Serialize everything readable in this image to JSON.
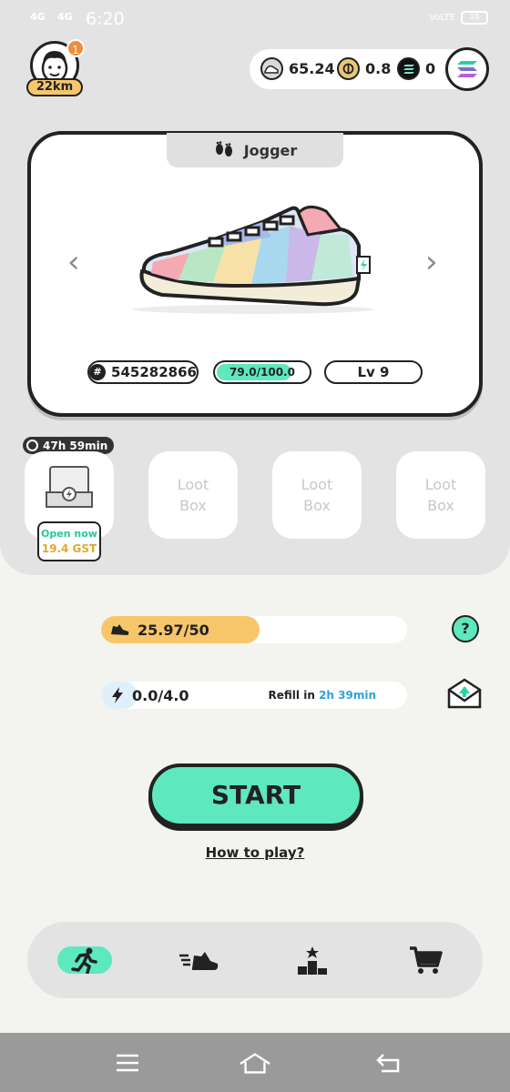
{
  "status_bar": {
    "signal_1": "4G",
    "signal_2": "4G",
    "time": "6:20",
    "volte": "VoLTE",
    "battery": "18"
  },
  "profile": {
    "notification_count": "1",
    "distance": "22km"
  },
  "balances": [
    {
      "icon": "gst-coin-icon",
      "value": "65.24"
    },
    {
      "icon": "gmt-coin-icon",
      "value": "0.8"
    },
    {
      "icon": "sol-coin-icon",
      "value": "0"
    }
  ],
  "sneaker": {
    "type": "Jogger",
    "id": "545282866",
    "durability": "79.0/100.0",
    "durability_fraction": 0.79,
    "level": "Lv 9",
    "colors": {
      "outline": "#222222",
      "sole": "#f2ecd9",
      "tongue": "#f4a9b3",
      "lace": "#a8b8e8"
    }
  },
  "mystery_box": {
    "timer": "47h 59min",
    "open_label": "Open now",
    "open_cost": "19.4 GST"
  },
  "loot_boxes": [
    {
      "line1": "Loot",
      "line2": "Box"
    },
    {
      "line1": "Loot",
      "line2": "Box"
    },
    {
      "line1": "Loot",
      "line2": "Box"
    }
  ],
  "earning_cap": {
    "value": "25.97/50",
    "fraction": 0.519,
    "color": "#f7c66a"
  },
  "energy": {
    "value": "0.0/4.0",
    "fraction": 0.0,
    "refill_label": "Refill in",
    "refill_time": "2h 39min"
  },
  "help": {
    "label": "?"
  },
  "start_button": {
    "label": "START"
  },
  "how_to_play": "How to play?",
  "bottom_nav": [
    {
      "name": "run",
      "icon": "running-person-icon",
      "active": true
    },
    {
      "name": "sneakers",
      "icon": "sneaker-icon",
      "active": false
    },
    {
      "name": "leaderboard",
      "icon": "podium-icon",
      "active": false
    },
    {
      "name": "marketplace",
      "icon": "cart-icon",
      "active": false
    }
  ],
  "accent_color": "#5ee8bd"
}
